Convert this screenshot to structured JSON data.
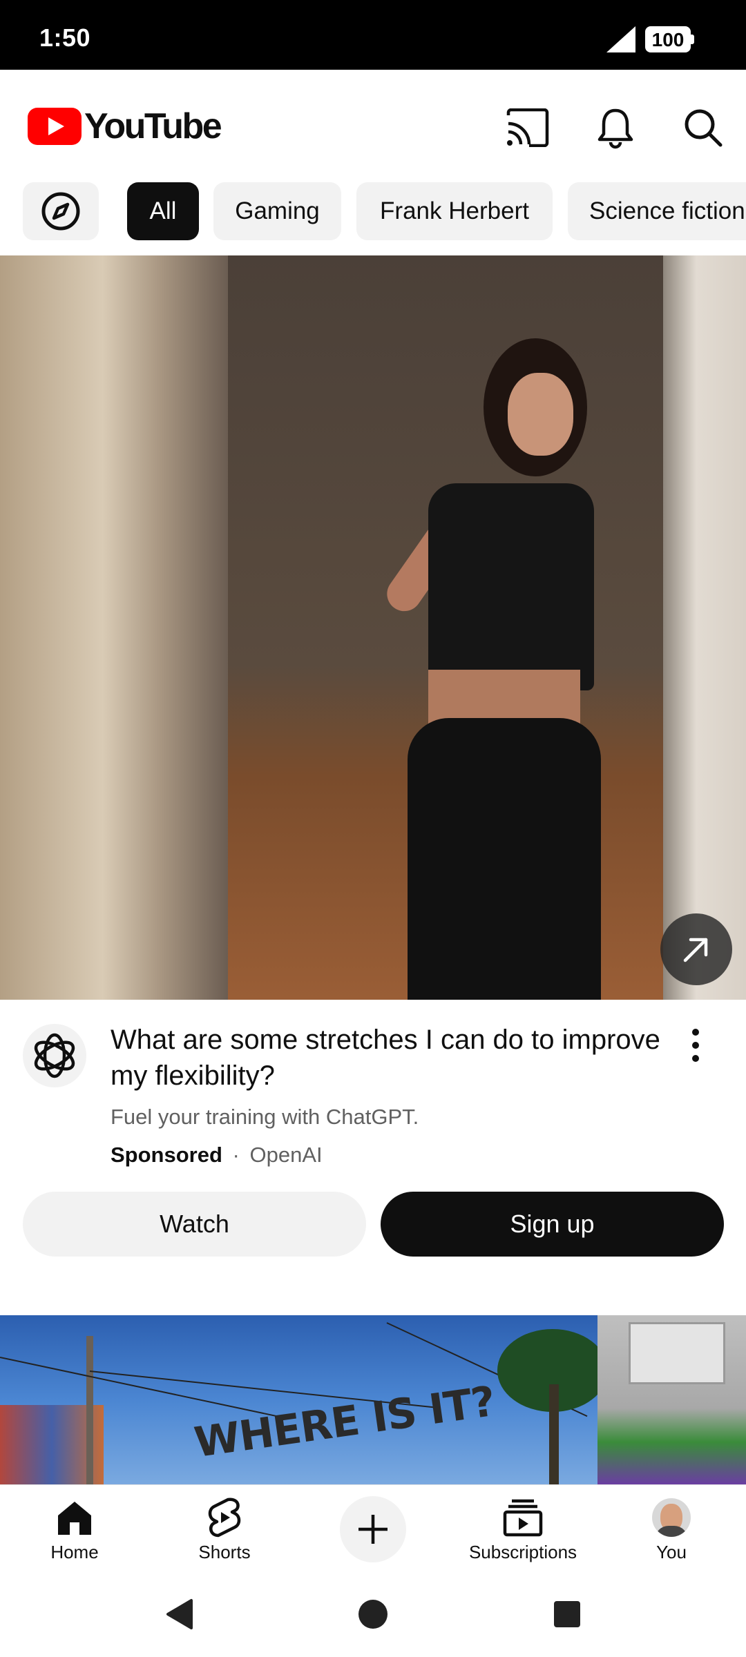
{
  "status_bar": {
    "time": "1:50",
    "battery": "100"
  },
  "header": {
    "logo_text": "YouTube",
    "icons": [
      "cast-icon",
      "notifications-bell-icon",
      "search-icon"
    ]
  },
  "chips": {
    "explore_icon": "compass-icon",
    "items": [
      "All",
      "Gaming",
      "Frank Herbert",
      "Science fiction"
    ],
    "active": "All"
  },
  "ad": {
    "title": "What are some stretches I can do to improve my flexibility?",
    "description": "Fuel your training with ChatGPT.",
    "sponsored_label": "Sponsored",
    "separator": "·",
    "advertiser": "OpenAI",
    "watch_label": "Watch",
    "signup_label": "Sign up",
    "expand_icon": "open-external-arrow-icon"
  },
  "next_video": {
    "thumbnail_text": "WHERE IS IT?"
  },
  "bottom_nav": {
    "home": "Home",
    "shorts": "Shorts",
    "create_icon": "plus-icon",
    "subscriptions": "Subscriptions",
    "you": "You"
  },
  "colors": {
    "brand_red": "#ff0000",
    "text": "#0f0f0f",
    "secondary": "#606060",
    "chip_bg": "#f2f2f2"
  }
}
